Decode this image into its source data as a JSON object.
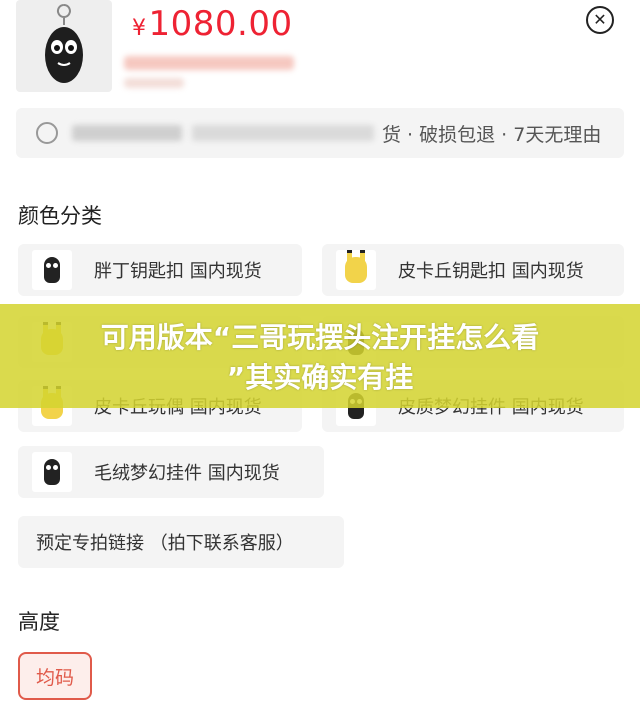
{
  "product": {
    "currency": "¥",
    "price": "1080.00",
    "thumb_icon": "black-keychain-figure"
  },
  "close_icon_glyph": "✕",
  "service": {
    "icon": "shield-icon",
    "text": "货 · 破损包退 · 7天无理由"
  },
  "color_section": {
    "title": "颜色分类",
    "options": [
      {
        "label": "胖丁钥匙扣 国内现货",
        "thumb": "black"
      },
      {
        "label": "皮卡丘钥匙扣 国内现货",
        "thumb": "yellow"
      },
      {
        "label": "",
        "thumb": "yellow"
      },
      {
        "label": "",
        "thumb": "black"
      },
      {
        "label": "皮卡丘玩偶 国内现货",
        "thumb": "yellow"
      },
      {
        "label": "皮质梦幻挂件 国内现货",
        "thumb": "black"
      },
      {
        "label": "毛绒梦幻挂件 国内现货",
        "thumb": "black"
      },
      {
        "label": "预定专拍链接 （拍下联系客服）",
        "thumb": ""
      }
    ]
  },
  "overlay": {
    "line1": "可用版本“三哥玩摆头注开挂怎么看",
    "line2": "”其实确实有挂"
  },
  "height_section": {
    "title": "高度",
    "selected_option": "均码"
  },
  "colors": {
    "price": "#ee2233",
    "selected_border": "#e05a4a",
    "overlay": "#d4d430"
  }
}
